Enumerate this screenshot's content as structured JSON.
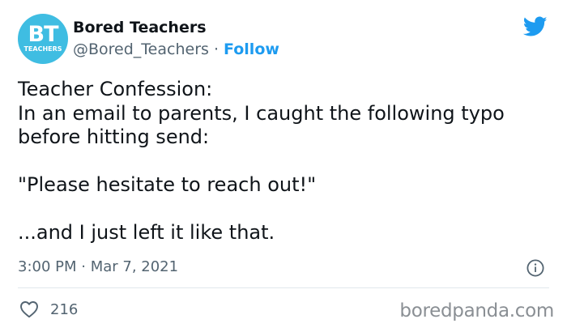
{
  "author": {
    "name": "Bored Teachers",
    "handle": "@Bored_Teachers",
    "separator": " · ",
    "follow_label": "Follow",
    "avatar": {
      "monogram": "BT",
      "subtitle": "TEACHERS",
      "color": "#3fbde2"
    }
  },
  "tweet": {
    "lines": [
      "Teacher Confession:",
      "In an email to parents, I caught the following typo",
      "before hitting send:",
      "",
      "\"Please hesitate to reach out!\"",
      "",
      "...and I just left it like that."
    ],
    "timestamp": "3:00 PM · Mar 7, 2021",
    "likes": "216"
  },
  "icons": {
    "brand": "twitter-bird-icon",
    "info": "info-icon",
    "like": "heart-icon"
  },
  "watermark": "boredpanda.com",
  "colors": {
    "accent": "#1d9bf0",
    "text": "#0f1419",
    "muted": "#536471"
  }
}
